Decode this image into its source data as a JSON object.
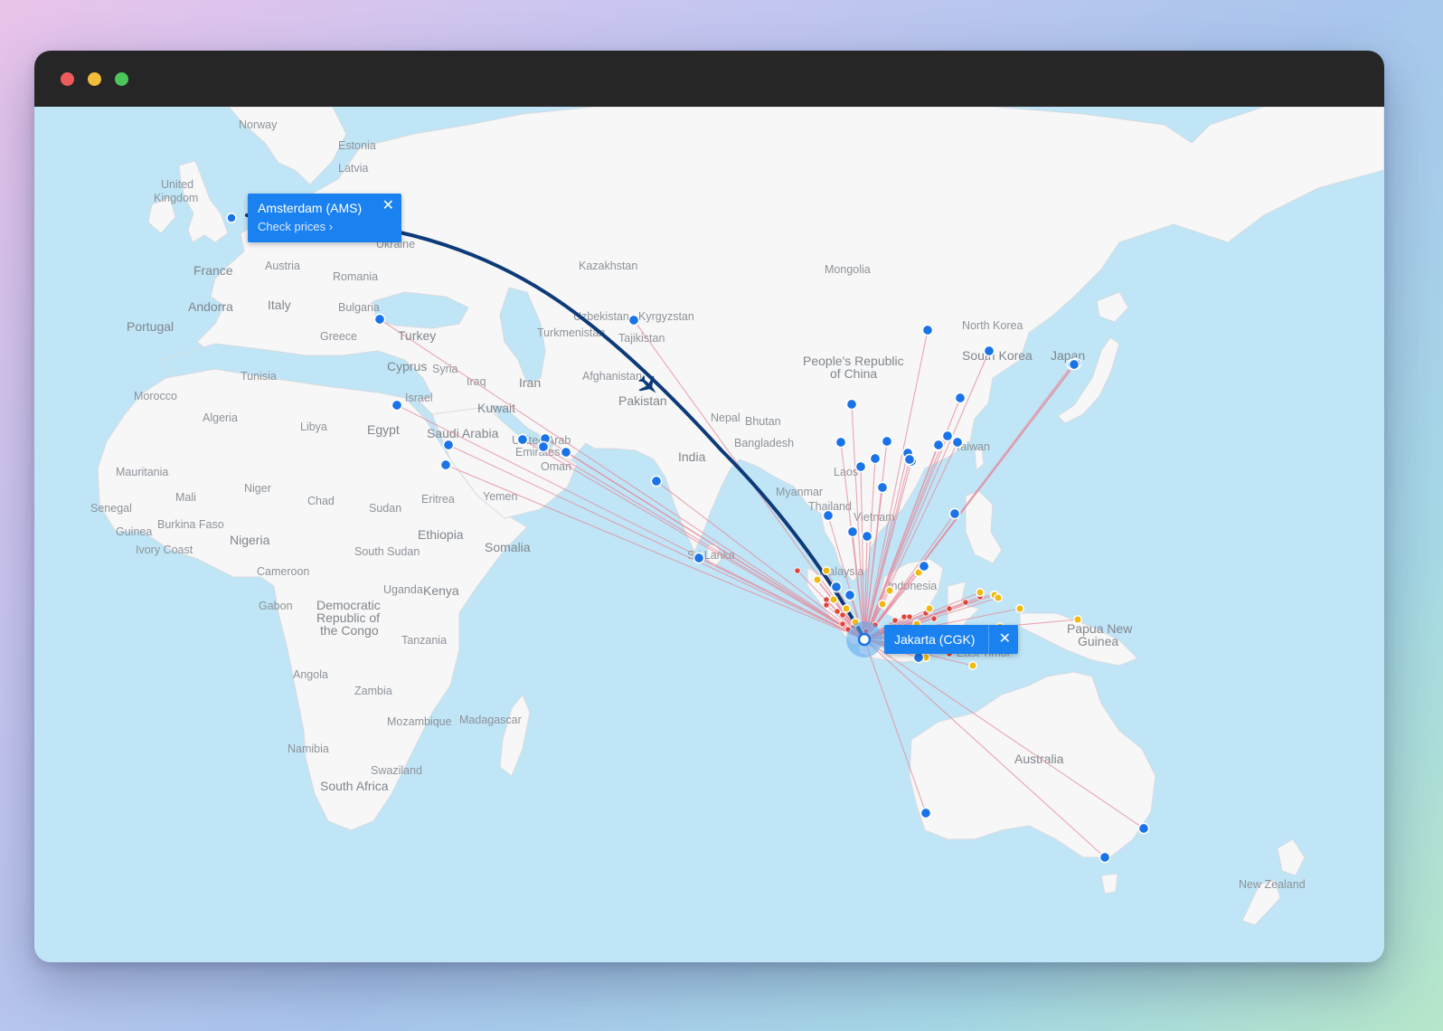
{
  "window": {
    "controls": [
      "close",
      "minimize",
      "zoom"
    ]
  },
  "colors": {
    "sea": "#bfe5f6",
    "land": "#f7f7f7",
    "route_line": "#e58a9b",
    "selected_route": "#0d3a78",
    "airport_blue": "#1a73e8",
    "airport_red": "#e0453a",
    "airport_yellow": "#f2b90f",
    "popup": "#1a82f0"
  },
  "origin_popup": {
    "city": "Jakarta (CGK)",
    "close_icon": "close-icon"
  },
  "destination_popup": {
    "city": "Amsterdam (AMS)",
    "link": "Check prices",
    "link_icon": "chevron-right-icon",
    "close_icon": "close-icon"
  },
  "map_labels": {
    "norway": "Norway",
    "estonia": "Estonia",
    "latvia": "Latvia",
    "uk1": "United",
    "uk2": "Kingdom",
    "ukraine": "Ukraine",
    "france": "France",
    "austria": "Austria",
    "romania": "Romania",
    "andorra": "Andorra",
    "italy": "Italy",
    "bulgaria": "Bulgaria",
    "portugal": "Portugal",
    "greece": "Greece",
    "turkey": "Turkey",
    "cyprus": "Cyprus",
    "syria": "Syria",
    "iraq": "Iraq",
    "iran": "Iran",
    "israel": "Israel",
    "kuwait": "Kuwait",
    "tunisia": "Tunisia",
    "morocco": "Morocco",
    "algeria": "Algeria",
    "libya": "Libya",
    "egypt": "Egypt",
    "saudi": "Saudi Arabia",
    "uae": "United Arab",
    "emirates": "Emirates",
    "oman": "Oman",
    "yemen": "Yemen",
    "kazakhstan": "Kazakhstan",
    "mongolia": "Mongolia",
    "uzbekistan": "Uzbekistan",
    "kyrgyzstan": "Kyrgyzstan",
    "turkmenistan": "Turkmenistan",
    "tajikistan": "Tajikistan",
    "afghanistan": "Afghanistan",
    "pakistan": "Pakistan",
    "nepal": "Nepal",
    "bhutan": "Bhutan",
    "india": "India",
    "bangladesh": "Bangladesh",
    "myanmar": "Myanmar",
    "thailand": "Thailand",
    "laos": "Laos",
    "vietnam": "Vietnam",
    "srilanka": "Sri Lanka",
    "malaysia": "Malaysia",
    "indonesia": "Indonesia",
    "easttimor": "East Timor",
    "china1": "People's Republic",
    "china2": "of China",
    "northkorea": "North Korea",
    "southkorea": "South Korea",
    "japan": "Japan",
    "taiwan": "Taiwan",
    "png1": "Papua New",
    "png2": "Guinea",
    "australia": "Australia",
    "newzealand": "New Zealand",
    "mauritania": "Mauritania",
    "mali": "Mali",
    "niger": "Niger",
    "chad": "Chad",
    "sudan": "Sudan",
    "eritrea": "Eritrea",
    "senegal": "Senegal",
    "burkina": "Burkina Faso",
    "guinea": "Guinea",
    "ivory": "Ivory Coast",
    "nigeria": "Nigeria",
    "ethiopia": "Ethiopia",
    "somalia": "Somalia",
    "southsudan": "South Sudan",
    "cameroon": "Cameroon",
    "gabon": "Gabon",
    "drc1": "Democratic",
    "drc2": "Republic of",
    "drc3": "the Congo",
    "uganda": "Uganda",
    "kenya": "Kenya",
    "tanzania": "Tanzania",
    "angola": "Angola",
    "zambia": "Zambia",
    "mozambique": "Mozambique",
    "madagascar": "Madagascar",
    "namibia": "Namibia",
    "swaziland": "Swaziland",
    "southafrica": "South Africa"
  },
  "routes": {
    "origin": "Jakarta (CGK)",
    "selected_destination": "Amsterdam (AMS)",
    "blue_destinations": 41,
    "red_destinations": 24,
    "yellow_destinations": 18
  }
}
